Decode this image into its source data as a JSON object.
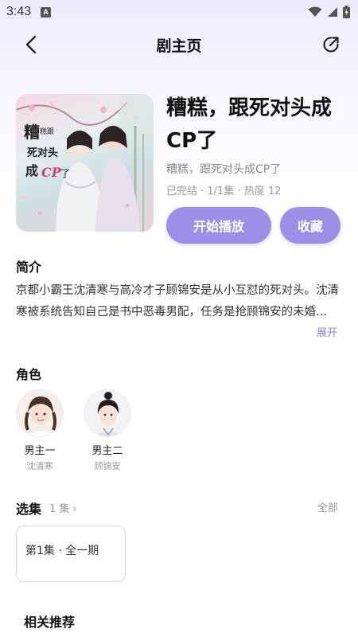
{
  "status": {
    "time": "3:43",
    "app_badge": "A"
  },
  "nav": {
    "title": "剧主页",
    "back_icon": "chevron-left-icon",
    "share_icon": "share-icon"
  },
  "drama": {
    "title": "糟糕，跟死对头成CP了",
    "subtitle": "糟糕，跟死对头成CP了",
    "meta": "已完结 · 1/1集 · 热度 12",
    "cover_text": "糟糕跟死对头成CP了"
  },
  "actions": {
    "play_label": "开始播放",
    "favorite_label": "收藏"
  },
  "intro": {
    "heading": "简介",
    "text": "京都小霸王沈清寒与高冷才子顾锦安是从小互怼的死对头。沈清寒被系统告知自己是书中恶毒男配，任务是抢顾锦安的未婚妻……",
    "expand_label": "展开"
  },
  "roles": {
    "heading": "角色",
    "items": [
      {
        "name": "男主一",
        "actor": "沈清寒"
      },
      {
        "name": "男主二",
        "actor": "顾锦安"
      }
    ]
  },
  "episodes": {
    "heading": "选集",
    "count_label": "1 集 ›",
    "all_label": "全部",
    "items": [
      {
        "label": "第1集 · 全一期"
      }
    ]
  },
  "related": {
    "heading": "相关推荐"
  },
  "colors": {
    "accent": "#9d8ee8",
    "accent_text": "#8e7fe0",
    "bg_top": "#eeeaff"
  }
}
